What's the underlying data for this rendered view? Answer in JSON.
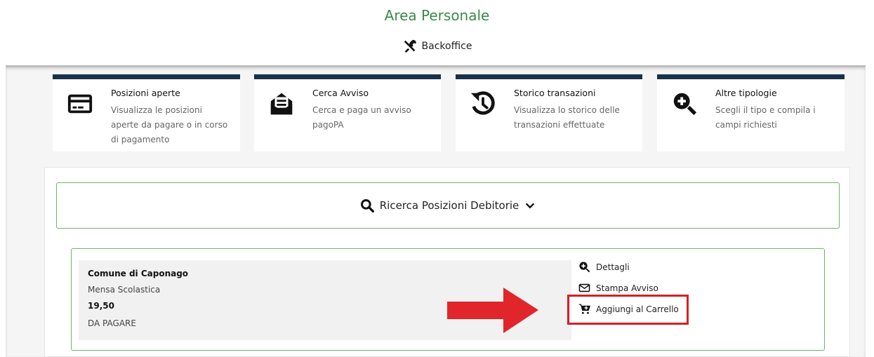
{
  "header": {
    "title": "Area Personale",
    "backoffice_label": "Backoffice"
  },
  "cards": [
    {
      "title": "Posizioni aperte",
      "desc": [
        "Visualizza le posizioni",
        "aperte da pagare o in corso",
        "di pagamento"
      ],
      "icon": "credit-card-icon"
    },
    {
      "title": "Cerca Avviso",
      "desc": [
        "Cerca e paga un avviso",
        "pagoPA"
      ],
      "icon": "envelope-search-icon"
    },
    {
      "title": "Storico transazioni",
      "desc": [
        "Visualizza lo storico delle",
        "transazioni effettuate"
      ],
      "icon": "history-icon"
    },
    {
      "title": "Altre tipologie",
      "desc": [
        "Scegli il tipo e compila i",
        "campi richiesti"
      ],
      "icon": "zoom-in-icon"
    }
  ],
  "search": {
    "label": "Ricerca Posizioni Debitorie"
  },
  "result": {
    "ente": "Comune di Caponago",
    "servizio": "Mensa Scolastica",
    "importo": "19,50",
    "stato": "DA PAGARE"
  },
  "actions": {
    "details": "Dettagli",
    "print": "Stampa Avviso",
    "add_to_cart": "Aggiungi al Carrello"
  },
  "colors": {
    "accent_green": "#3a8a4a",
    "card_border": "#17324a",
    "highlight_red": "#d42027"
  }
}
